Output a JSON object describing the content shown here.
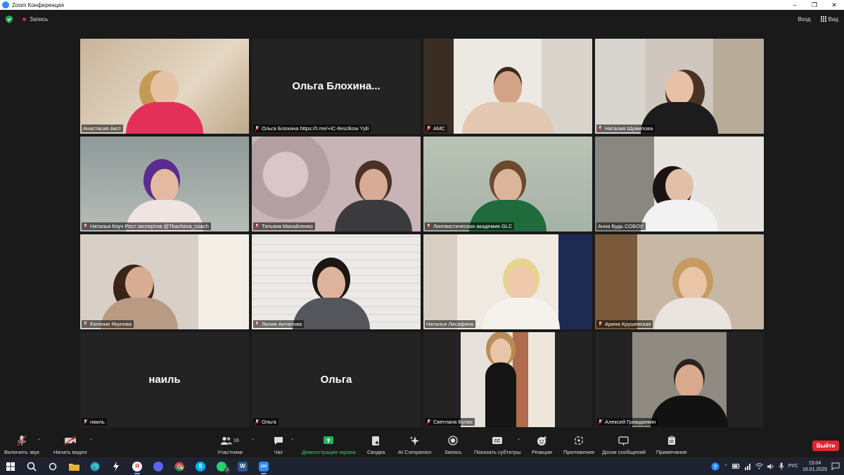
{
  "window": {
    "title": "Zoom Конференция"
  },
  "topbar": {
    "record_label": "Запись",
    "enter_label": "Вход",
    "view_label": "Вид"
  },
  "tiles": [
    {
      "name": "Анастасия Акст",
      "active": true,
      "video": true,
      "muted": false
    },
    {
      "name": "Ольга Блохина  https://t.me/+iC-tlesclksw Yjdi",
      "display_name": "Ольга  Блохина...",
      "video": false,
      "muted": true
    },
    {
      "name": "AMC",
      "video": true,
      "muted": true
    },
    {
      "name": "Наталия Шумилова",
      "video": true,
      "muted": true
    },
    {
      "name": "Наталья Коуч Рост экспертов @Tkacheva_coach",
      "video": true,
      "muted": true
    },
    {
      "name": "Татьяна Михайленко",
      "video": true,
      "muted": true
    },
    {
      "name": "Лингвистическая академия GLC",
      "video": true,
      "muted": true
    },
    {
      "name": "Анна Будь СОБОУ",
      "video": true,
      "muted": false
    },
    {
      "name": "Евгения Якупова",
      "video": true,
      "muted": true
    },
    {
      "name": "Лилия Антилова",
      "video": true,
      "muted": true
    },
    {
      "name": "Наталья Лисафина",
      "video": true,
      "muted": false
    },
    {
      "name": "Арина Крушевская",
      "video": true,
      "muted": true
    },
    {
      "name": "наиль",
      "display_name": "наиль",
      "video": false,
      "muted": true
    },
    {
      "name": "Ольга",
      "display_name": "Ольга",
      "video": false,
      "muted": true
    },
    {
      "name": "Светлана Булах",
      "video": true,
      "muted": true
    },
    {
      "name": "Алексей Гражданкин",
      "video": true,
      "muted": true
    }
  ],
  "toolbar": {
    "unmute": "Включить звук",
    "start_video": "Начать видео",
    "participants": "Участники",
    "participants_count": "16",
    "chat": "Чат",
    "share": "Демонстрация экрана",
    "summary": "Сводка",
    "ai": "AI Companion",
    "record": "Запись",
    "captions": "Показать субтитры",
    "reactions": "Реакции",
    "apps": "Приложения",
    "whiteboards": "Доски сообщений",
    "notes": "Примечания",
    "leave": "Выйти"
  },
  "taskbar": {
    "lang": "РУС",
    "time": "15:04",
    "date": "16.01.2025",
    "whatsapp_badge": "2",
    "word_letter": "W",
    "zoom_letters": "zm",
    "yandex_letter": "Я",
    "skype_letter": "S"
  },
  "colors": {
    "active_speaker": "#c3e05a",
    "leave": "#e0262f",
    "share_green": "#33d36b",
    "muted_red": "#e02828"
  }
}
